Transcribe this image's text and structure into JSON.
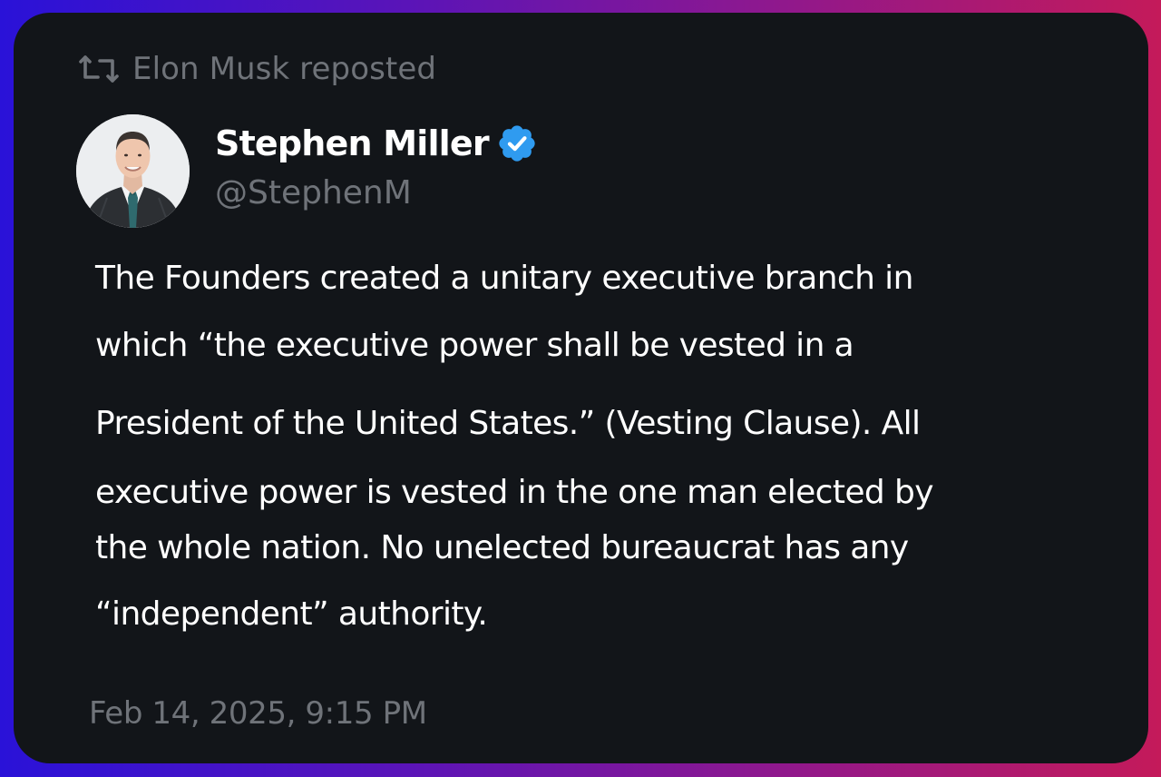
{
  "repost": {
    "icon": "repost-icon",
    "text": "Elon Musk reposted"
  },
  "author": {
    "name": "Stephen Miller",
    "handle": "@StephenM",
    "verified_icon": "verified-badge-icon",
    "verified_color": "#2f9bf0"
  },
  "tweet": {
    "lines": [
      "The Founders created a unitary executive branch in",
      "which “the executive power shall be vested in a",
      "President of the United States.” (Vesting Clause). All",
      "executive power is vested in the one man elected by",
      "the whole nation. No unelected bureaucrat has any",
      "“independent” authority."
    ]
  },
  "timestamp": "Feb 14, 2025, 9:15 PM",
  "colors": {
    "card_bg": "#121519",
    "text_primary": "#ffffff",
    "text_secondary": "#6f7379"
  }
}
